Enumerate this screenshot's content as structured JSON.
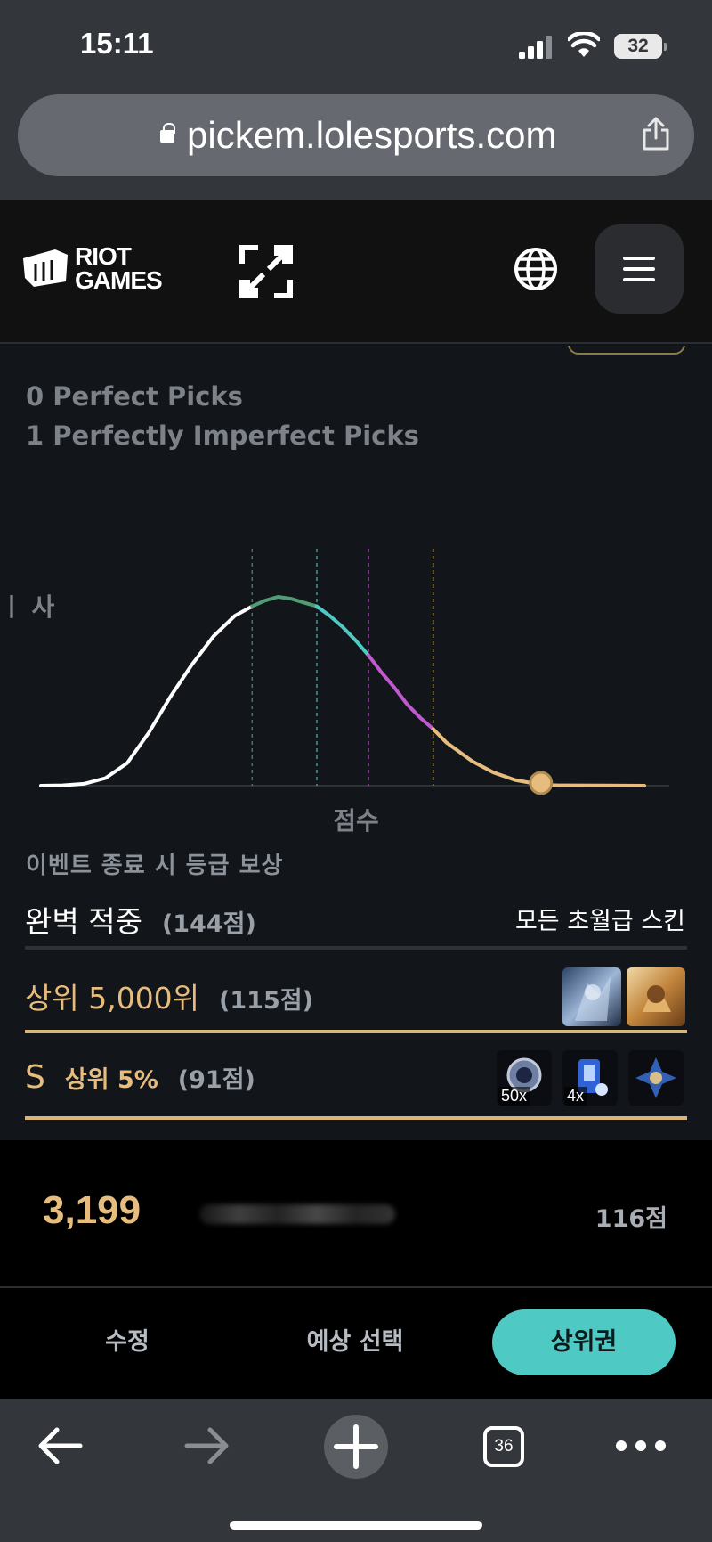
{
  "status_bar": {
    "time": "15:11",
    "battery": "32"
  },
  "browser": {
    "url": "pickem.lolesports.com",
    "tab_count": "36"
  },
  "header": {
    "logo_line1": "RIOT",
    "logo_line2": "GAMES"
  },
  "stats": {
    "perfect_picks": "0 Perfect Picks",
    "imperfect_picks": "1 Perfectly Imperfect Picks"
  },
  "chart_data": {
    "type": "area",
    "y_axis_label_fragment": "ㅣ 사",
    "xlabel": "점수",
    "thresholds": [
      {
        "value": 49,
        "label": "49",
        "color": "#4f9d74"
      },
      {
        "value": 64,
        "label": "64",
        "color": "#4fc9c4"
      },
      {
        "value": 76,
        "label": "76",
        "color": "#c058d0"
      },
      {
        "value": 91,
        "label": "91",
        "color": "#e6bd7e"
      }
    ],
    "user_score": 116,
    "x": [
      0,
      5,
      10,
      15,
      20,
      25,
      30,
      35,
      40,
      45,
      49,
      52,
      55,
      58,
      61,
      64,
      67,
      70,
      73,
      76,
      79,
      82,
      85,
      88,
      91,
      94,
      97,
      100,
      105,
      110,
      116,
      120,
      130,
      140
    ],
    "values": [
      0,
      0.2,
      1,
      4,
      12,
      28,
      47,
      64,
      79,
      90,
      95,
      98,
      100,
      99,
      97,
      95,
      90,
      84,
      77,
      69,
      60,
      52,
      43,
      36,
      30,
      23,
      18,
      13,
      7,
      3,
      0.5,
      0.2,
      0.1,
      0
    ],
    "segment_colors": {
      "below_49": "#ffffff",
      "49_64": "#4f9d74",
      "64_76": "#4fc9c4",
      "76_91": "#c058d0",
      "above_91": "#e6bd7e"
    }
  },
  "rewards": {
    "title": "이벤트 종료 시 등급 보상",
    "rows": [
      {
        "label": "완벽 적중",
        "points": "(144점)",
        "reward": "모든 초월급 스킨"
      },
      {
        "label": "상위 5,000위",
        "points": "(115점)"
      },
      {
        "grade": "S",
        "label": "상위 5%",
        "points": "(91점)",
        "icon_qty": [
          "50x",
          "4x"
        ]
      }
    ]
  },
  "rank": {
    "position": "3,199",
    "score": "116점"
  },
  "bottom_nav": {
    "edit": "수정",
    "predict": "예상 선택",
    "top": "상위권"
  },
  "colors": {
    "gold": "#e6bd7e",
    "teal": "#4fc9c4",
    "purple": "#c058d0",
    "green": "#4f9d74"
  }
}
